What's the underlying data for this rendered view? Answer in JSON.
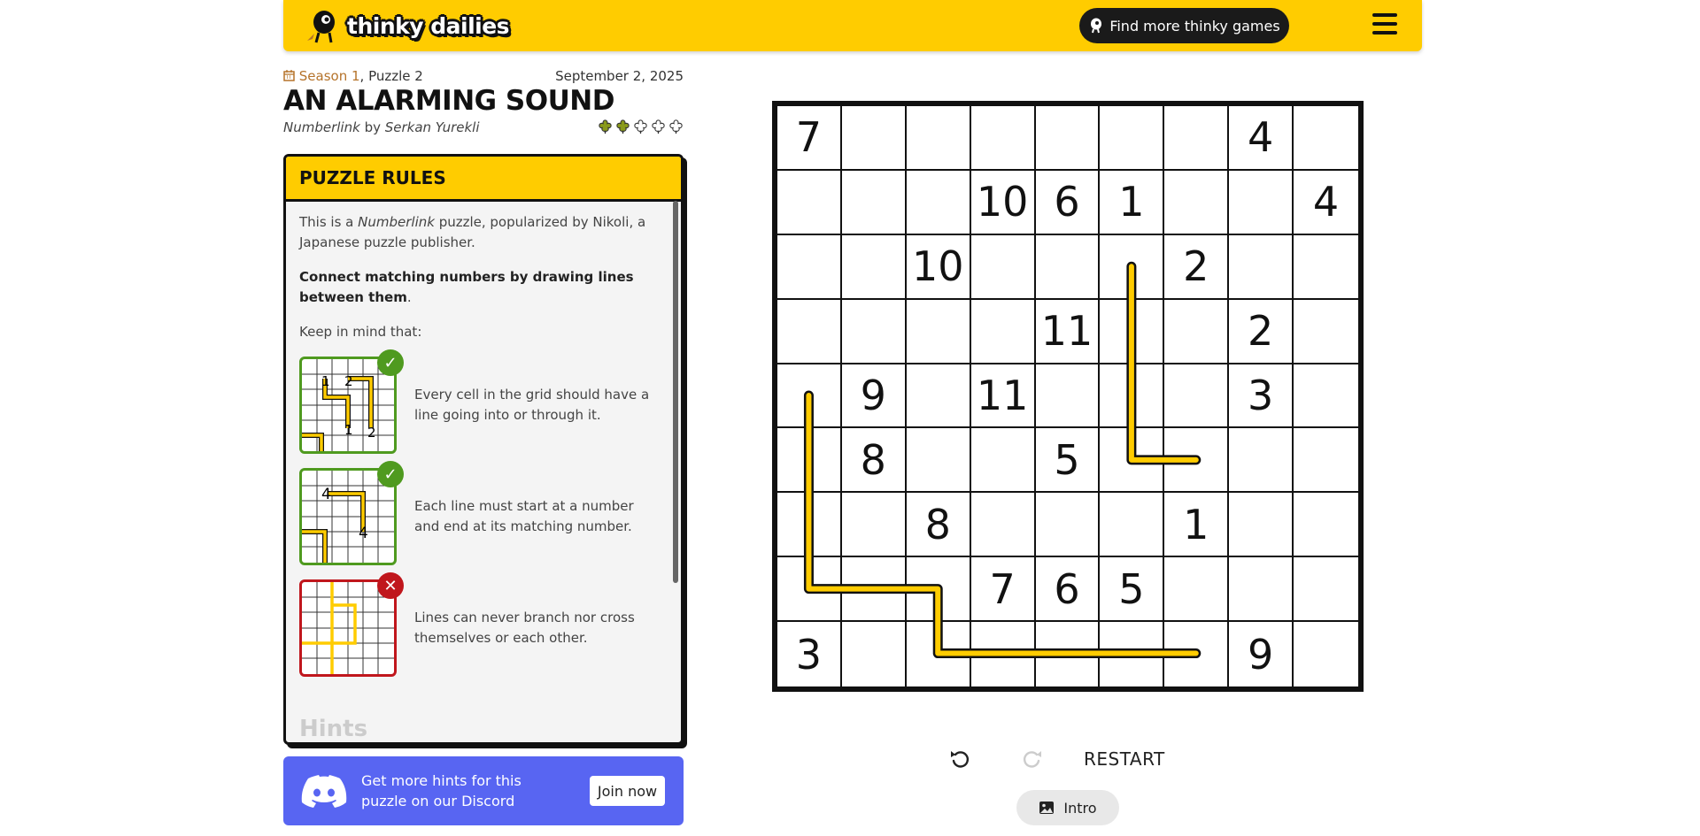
{
  "header": {
    "logo_text": "thinky dailies",
    "find_more_label": "Find more thinky games",
    "menu_icon": "hamburger-icon"
  },
  "puzzle": {
    "season_label": "Season 1",
    "puzzle_label": ", Puzzle 2",
    "date": "September 2, 2025",
    "title": "AN ALARMING SOUND",
    "genre": "Numberlink",
    "by_word": " by ",
    "author": "Serkan Yurekli",
    "difficulty_filled": 2,
    "difficulty_total": 5
  },
  "rules": {
    "heading": "PUZZLE RULES",
    "intro_a": "This is a ",
    "intro_genre": "Numberlink",
    "intro_b": " puzzle, popularized by Nikoli, a Japanese puzzle publisher.",
    "main_rule": "Connect matching numbers by drawing lines between them",
    "main_rule_end": ".",
    "keep_in_mind": "Keep in mind that:",
    "examples": [
      {
        "text": "Every cell in the grid should have a line going into or through it.",
        "status": "ok"
      },
      {
        "text": "Each line must start at a number and end at its matching number.",
        "status": "ok"
      },
      {
        "text": "Lines can never branch nor cross themselves or each other.",
        "status": "bad"
      }
    ],
    "hints_heading": "Hints"
  },
  "discord": {
    "text": "Get more hints for this puzzle on our Discord",
    "join_label": "Join now"
  },
  "board": {
    "size": 9,
    "cells": [
      [
        "7",
        "",
        "",
        "",
        "",
        "",
        "",
        "4",
        ""
      ],
      [
        "",
        "",
        "",
        "10",
        "6",
        "1",
        "",
        "",
        "4"
      ],
      [
        "",
        "",
        "10",
        "",
        "",
        "",
        "2",
        "",
        ""
      ],
      [
        "",
        "",
        "",
        "",
        "11",
        "",
        "",
        "2",
        ""
      ],
      [
        "",
        "9",
        "",
        "11",
        "",
        "",
        "",
        "3",
        ""
      ],
      [
        "",
        "8",
        "",
        "",
        "5",
        "",
        "",
        "",
        ""
      ],
      [
        "",
        "",
        "8",
        "",
        "",
        "",
        "1",
        "",
        ""
      ],
      [
        "",
        "",
        "",
        "7",
        "6",
        "5",
        "",
        "",
        ""
      ],
      [
        "3",
        "",
        "",
        "",
        "",
        "",
        "",
        "9",
        ""
      ]
    ],
    "drawn_paths": [
      [
        [
          2,
          5
        ],
        [
          5,
          5
        ],
        [
          5,
          6
        ]
      ],
      [
        [
          4,
          0
        ],
        [
          7,
          0
        ],
        [
          7,
          2
        ],
        [
          8,
          2
        ],
        [
          8,
          6
        ]
      ]
    ],
    "path_color": "#ffcc00"
  },
  "controls": {
    "undo_icon": "undo-icon",
    "redo_icon": "redo-icon",
    "restart_label": "RESTART",
    "intro_label": "Intro",
    "intro_icon": "image-icon"
  },
  "colors": {
    "brand_yellow": "#ffcc00",
    "discord_blue": "#5865f2",
    "ok_green": "#4f9a1f",
    "bad_red": "#c0161c"
  }
}
